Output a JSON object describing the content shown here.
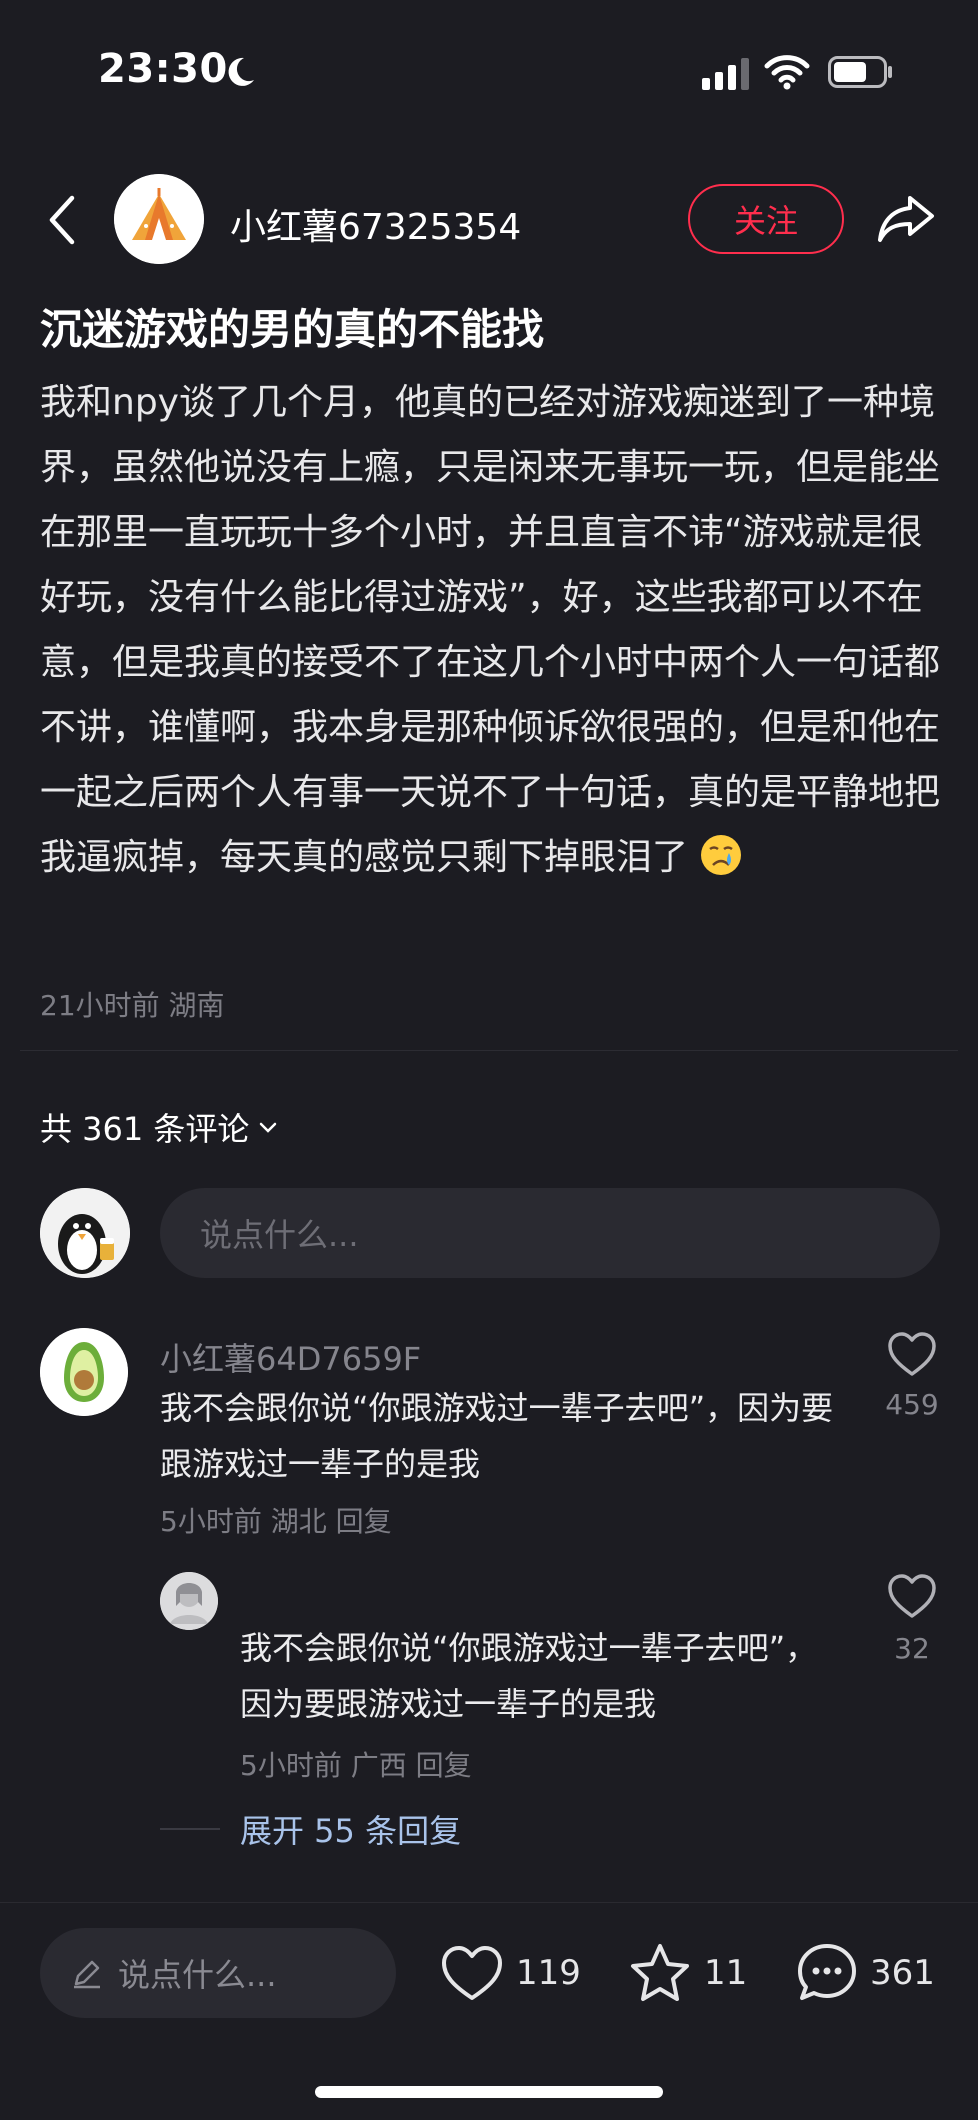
{
  "status_bar": {
    "time": "23:30",
    "icons": [
      "moon-icon",
      "signal-icon",
      "wifi-icon",
      "battery-icon"
    ]
  },
  "header": {
    "author_name": "小红薯67325354",
    "follow_label": "关注",
    "icons": [
      "back-icon",
      "tent-avatar",
      "share-icon"
    ],
    "accent_color": "#ff2e4d"
  },
  "post": {
    "title": "沉迷游戏的男的真的不能找",
    "body": "我和npy谈了几个月，他真的已经对游戏痴迷到了一种境界，虽然他说没有上瘾，只是闲来无事玩一玩，但是能坐在那里一直玩玩十多个小时，并且直言不讳“游戏就是很好玩，没有什么能比得过游戏”，好，这些我都可以不在意，但是我真的接受不了在这几个小时中两个人一句话都不讲，谁懂啊，我本身是那种倾诉欲很强的，但是和他在一起之后两个人有事一天说不了十句话，真的是平静地把我逼疯掉，每天真的感觉只剩下掉眼泪了",
    "emoji": "crying-face-emoji",
    "meta": "21小时前 湖南"
  },
  "comments_section": {
    "count_label": "共 361 条评论",
    "input_placeholder": "说点什么...",
    "comments": [
      {
        "user": "小红薯64D7659F",
        "text": "我不会跟你说“你跟游戏过一辈子去吧”，因为要跟游戏过一辈子的是我",
        "meta": "5小时前 湖北 回复",
        "likes": "459",
        "avatar": "avocado-avatar",
        "replies": [
          {
            "text": "我不会跟你说“你跟游戏过一辈子去吧”，因为要跟游戏过一辈子的是我",
            "meta": "5小时前 广西 回复",
            "likes": "32"
          }
        ],
        "expand_label": "展开 55 条回复"
      }
    ]
  },
  "bottom_bar": {
    "input_placeholder": "说点什么...",
    "likes": "119",
    "stars": "11",
    "comments": "361",
    "icons": [
      "pencil-icon",
      "heart-icon",
      "star-icon",
      "comment-bubble-icon"
    ]
  }
}
